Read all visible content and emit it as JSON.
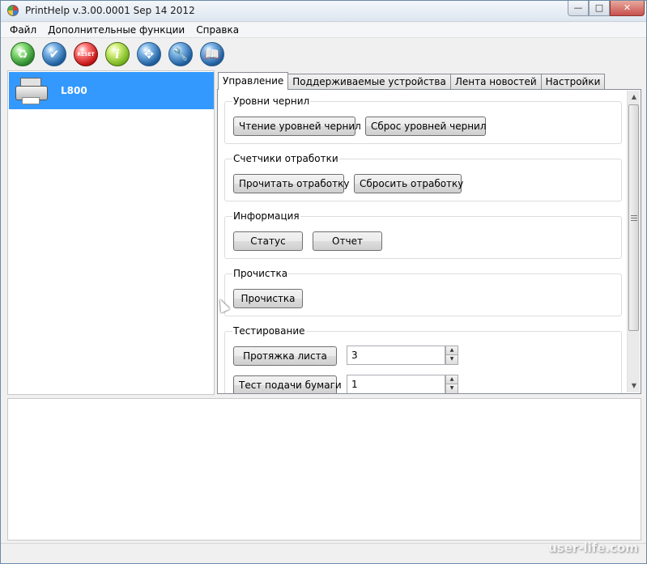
{
  "window": {
    "title": "PrintHelp v.3.00.0001 Sep 14 2012",
    "caption_buttons": [
      "—",
      "□",
      "✕"
    ]
  },
  "menu": [
    "Файл",
    "Дополнительные функции",
    "Справка"
  ],
  "toolbar": {
    "buttons": [
      {
        "icon": "recycle-icon",
        "glyph": "♻"
      },
      {
        "icon": "check-icon",
        "glyph": "✔"
      },
      {
        "icon": "reset-icon",
        "glyph": "RESET"
      },
      {
        "icon": "info-icon",
        "glyph": "i"
      },
      {
        "icon": "network-icon",
        "glyph": "✥"
      },
      {
        "icon": "wrench-icon",
        "glyph": "🔧"
      },
      {
        "icon": "book-icon",
        "glyph": "📖"
      }
    ]
  },
  "printers": [
    {
      "name": "L800",
      "selected": true
    }
  ],
  "tabs": [
    {
      "label": "Управление",
      "active": true
    },
    {
      "label": "Поддерживаемые устройства",
      "active": false
    },
    {
      "label": "Лента новостей",
      "active": false
    },
    {
      "label": "Настройки",
      "active": false
    }
  ],
  "groups": {
    "ink": {
      "title": "Уровни чернил",
      "read_button": "Чтение уровней чернил",
      "reset_button": "Сброс уровней чернил"
    },
    "counters": {
      "title": "Счетчики отработки",
      "read_button": "Прочитать отработку",
      "reset_button": "Сбросить отработку"
    },
    "info": {
      "title": "Информация",
      "status_button": "Статус",
      "report_button": "Отчет"
    },
    "cleaning": {
      "title": "Прочистка",
      "clean_button": "Прочистка"
    },
    "testing": {
      "title": "Тестирование",
      "feed_sheet_button": "Протяжка листа",
      "feed_sheet_value": "3",
      "paper_feed_button": "Тест подачи бумаги",
      "paper_feed_value": "1"
    }
  },
  "watermark": "user-life.com",
  "colors": {
    "selection": "#3399ff",
    "window_bg": "#f0f0f0",
    "panel_bg": "#ffffff"
  }
}
